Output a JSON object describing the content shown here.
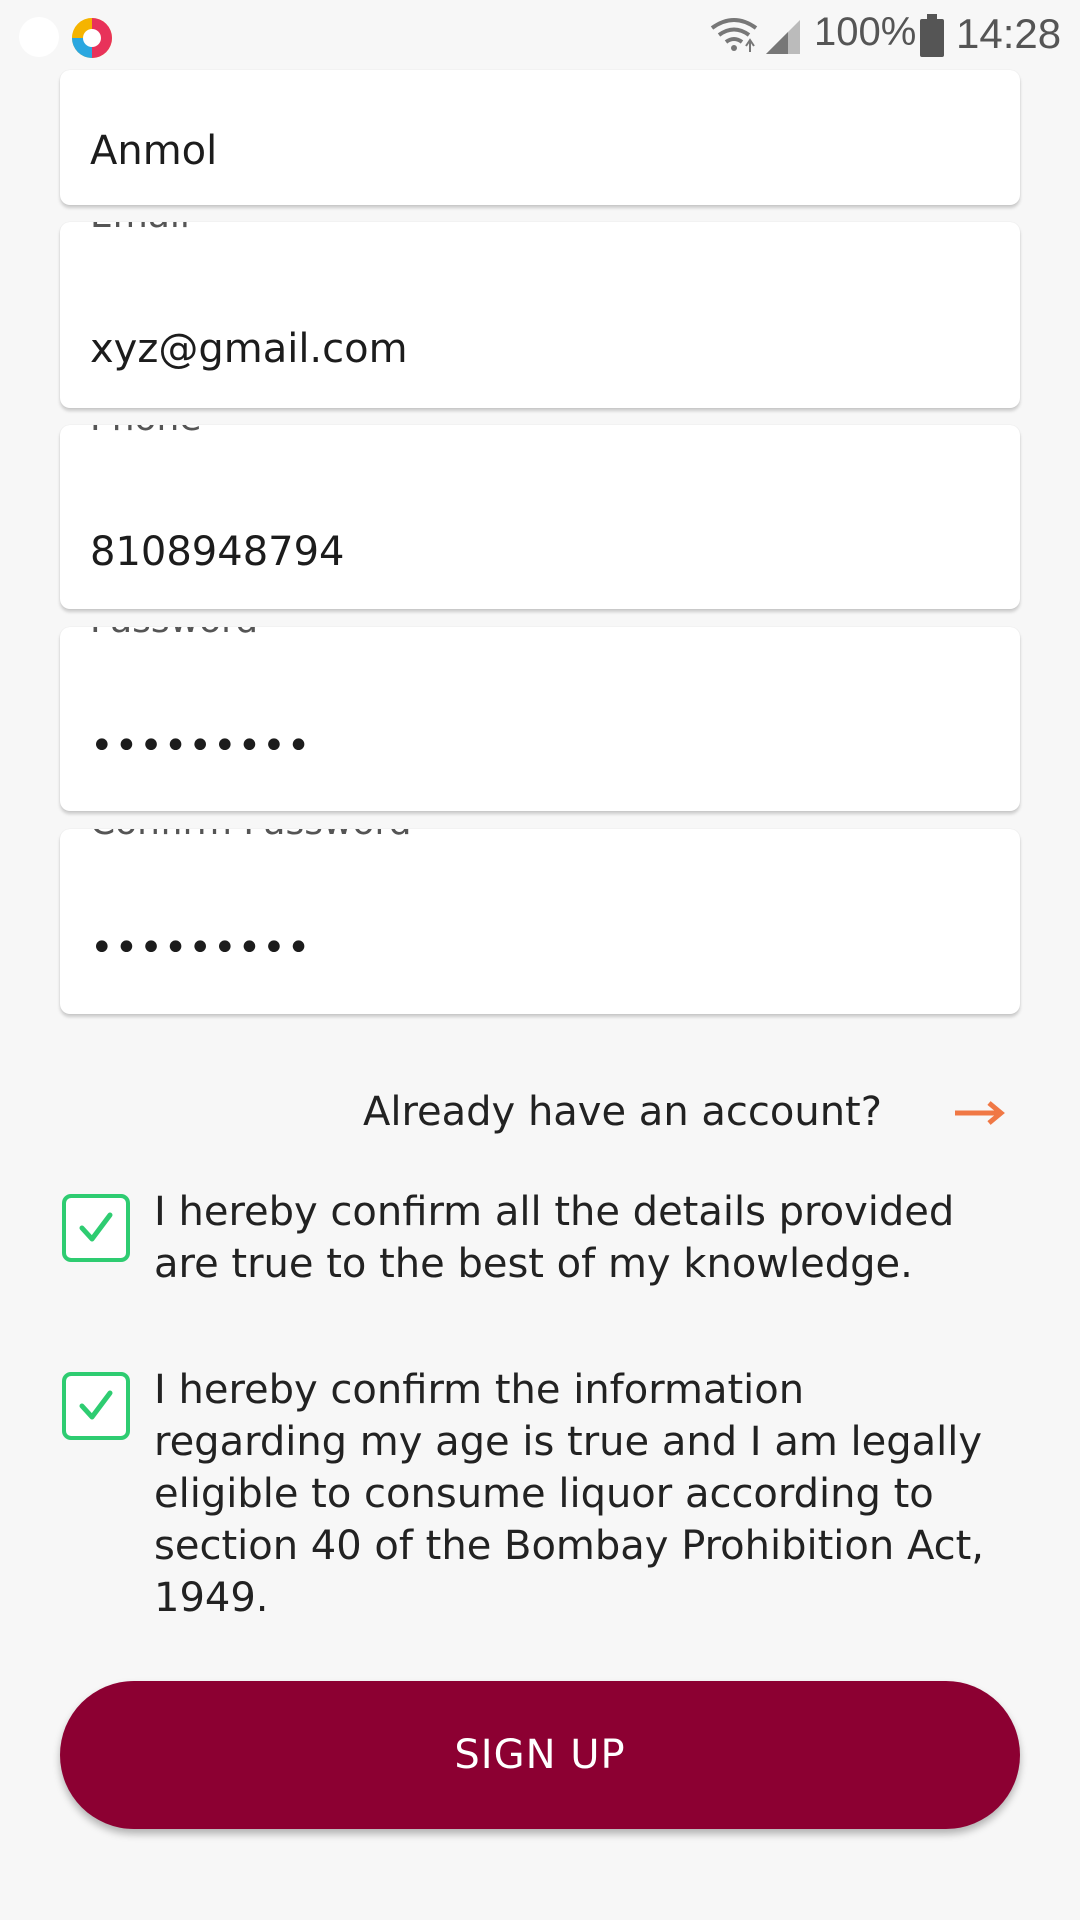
{
  "status_bar": {
    "battery": "100%",
    "time": "14:28",
    "icons": [
      "app-logo-icon",
      "wifi-icon",
      "signal-icon",
      "battery-icon"
    ]
  },
  "form": {
    "name": {
      "value": "Anmol"
    },
    "email": {
      "label": "Email",
      "value": "xyz@gmail.com"
    },
    "phone": {
      "label": "Phone",
      "value": "8108948794"
    },
    "password": {
      "label": "Password",
      "value": "•••••••••"
    },
    "confirm_password": {
      "label": "Confirm Password",
      "value": "•••••••••"
    }
  },
  "login_link": {
    "text": "Already have an account?",
    "icon": "arrow-right-icon"
  },
  "consents": [
    {
      "checked": true,
      "text": "I hereby confirm all the details provided are true to the best of my knowledge."
    },
    {
      "checked": true,
      "text": "I hereby confirm the information regarding my age is true and I am legally eligible to consume liquor according to section 40 of the Bombay Prohibition Act, 1949."
    }
  ],
  "signup_button": {
    "label": "SIGN UP"
  },
  "colors": {
    "accent": "#8c0032",
    "checkbox": "#2ecc71",
    "arrow": "#f07845",
    "background": "#f7f7f7"
  }
}
